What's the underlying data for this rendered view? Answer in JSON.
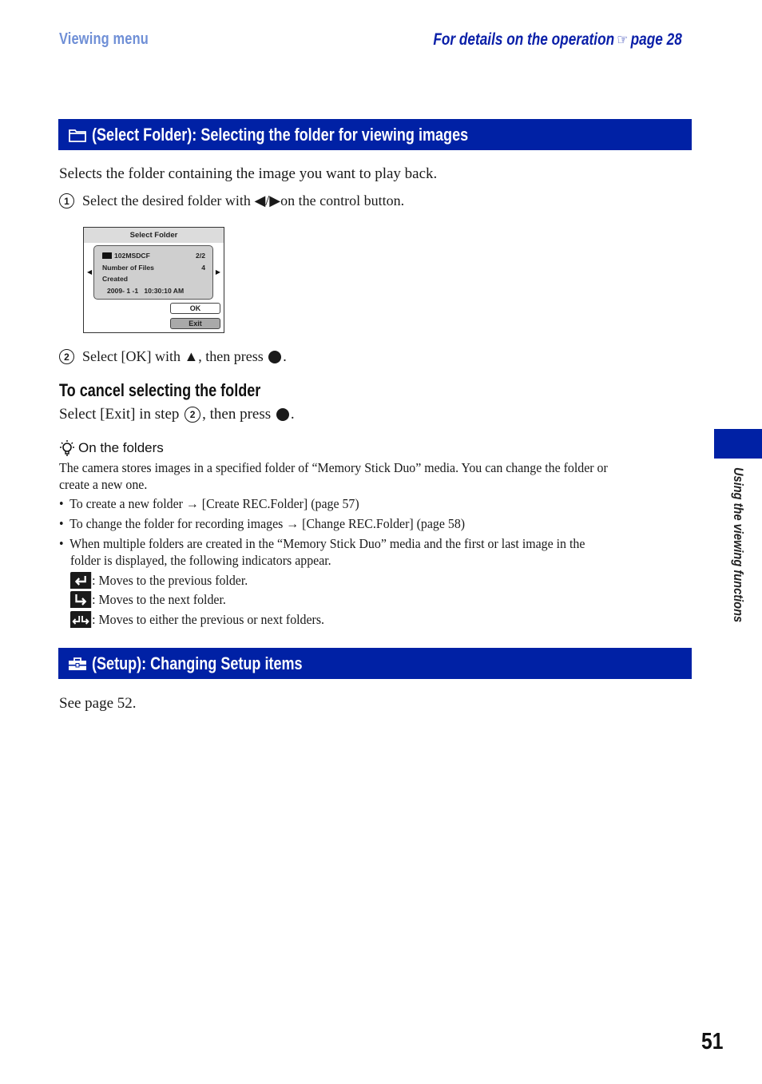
{
  "header": {
    "section": "Viewing menu",
    "ref_text": "For details on the operation",
    "ref_icon": "pointing-hand-icon",
    "ref_page": "page 28"
  },
  "select_folder": {
    "icon": "folder-icon",
    "title": "(Select Folder): Selecting the folder for viewing images",
    "intro": "Selects the folder containing the image you want to play back.",
    "steps": [
      {
        "num": "1",
        "text_before": "Select the desired folder with ",
        "symbol": "◀/▶",
        "text_after": " on the control button."
      },
      {
        "num": "2",
        "text_before": "Select [OK] with ",
        "symbol": "▲",
        "text_after": ", then press ",
        "end": "."
      }
    ],
    "screen": {
      "title": "Select Folder",
      "folder_name": "102MSDCF",
      "folder_index": "2/2",
      "files_label": "Number of Files",
      "files_count": "4",
      "created_label": "Created",
      "created_value": "2009- 1 -1   10:30:10 AM",
      "left_arrow": "◀",
      "right_arrow": "▶",
      "ok_label": "OK",
      "exit_label": "Exit"
    },
    "cancel_heading": "To cancel selecting the folder",
    "cancel_text_before": "Select [Exit] in step ",
    "cancel_step": "2",
    "cancel_text_after": ", then press ",
    "cancel_end": "."
  },
  "tip": {
    "icon": "lightbulb-hint-icon",
    "title": "On the folders",
    "para_line1": "The camera stores images in a specified folder of “Memory Stick Duo” media. You can change the folder or",
    "para_line2": "create a new one.",
    "bullets": [
      {
        "text": "To create a new folder ",
        "arrow": "→",
        "ref": " [Create REC.Folder] (page 57)"
      },
      {
        "text": "To change the folder for recording images ",
        "arrow": "→",
        "ref": " [Change REC.Folder] (page 58)"
      },
      {
        "line1": "When multiple folders are created in the “Memory Stick Duo” media and the first or last image in the",
        "line2": "folder is displayed, the following indicators appear."
      }
    ],
    "indicators": [
      {
        "icon": "previous-folder-icon",
        "text": ": Moves to the previous folder."
      },
      {
        "icon": "next-folder-icon",
        "text": ": Moves to the next folder."
      },
      {
        "icon": "previous-or-next-folder-icon",
        "text": ": Moves to either the previous or next folders."
      }
    ]
  },
  "setup": {
    "icon": "toolbox-icon",
    "title": "(Setup): Changing Setup items",
    "text": "See page 52."
  },
  "side_tab": {
    "label": "Using the viewing functions"
  },
  "page_number": "51",
  "colors": {
    "accent_bar": "#0021a5",
    "header_section": "#6f8fd6",
    "header_ref": "#0a1fa8"
  }
}
